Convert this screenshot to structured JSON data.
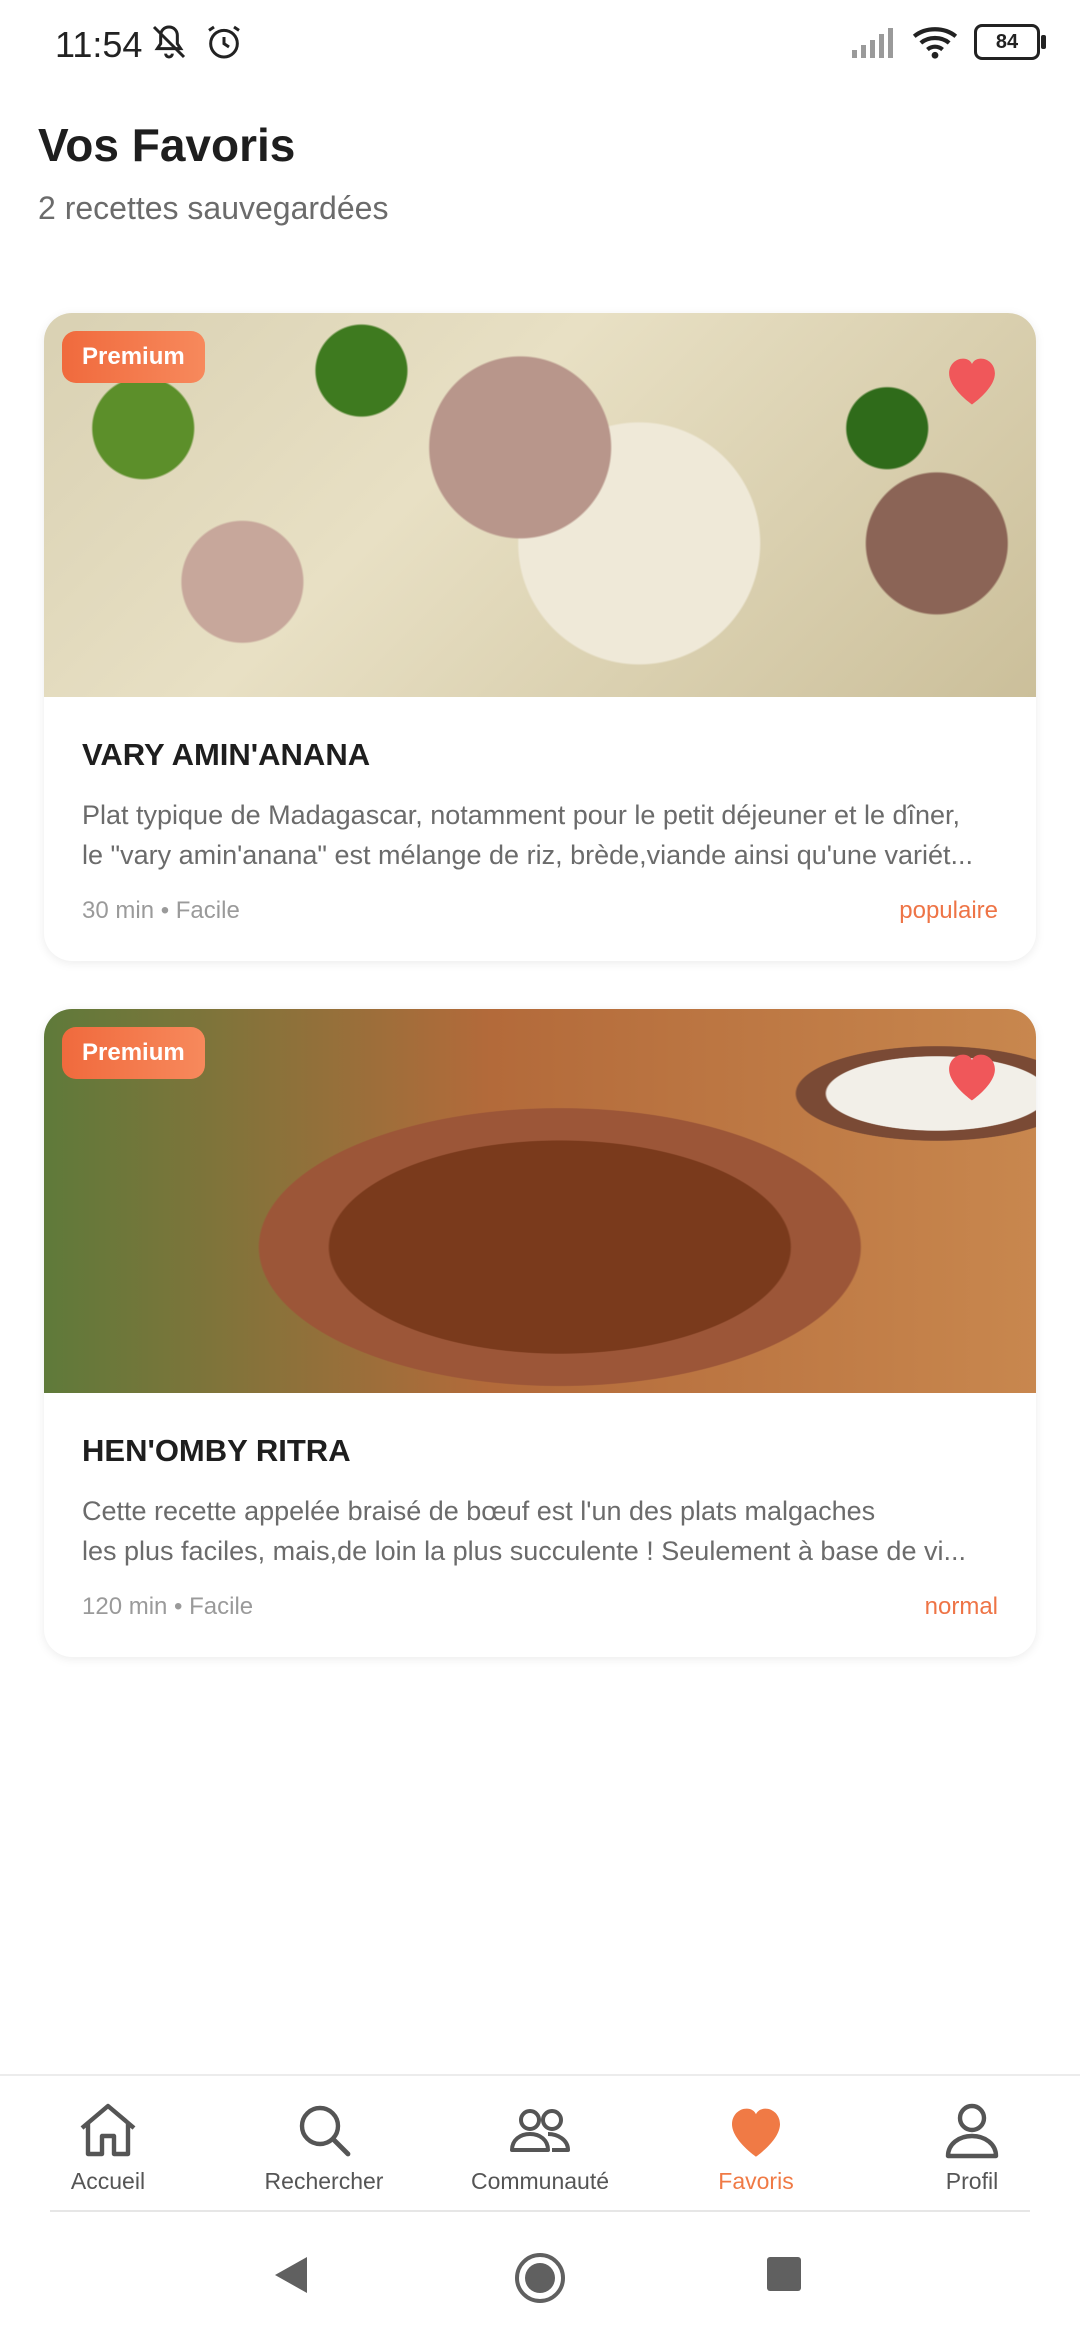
{
  "status_bar": {
    "time": "11:54",
    "battery": "84",
    "icons": [
      "bell-off-icon",
      "alarm-icon",
      "signal-icon",
      "wifi-icon",
      "battery-icon"
    ]
  },
  "header": {
    "title": "Vos Favoris",
    "subtitle": "2 recettes sauvegardées"
  },
  "recipes": [
    {
      "badge": "Premium",
      "title": "VARY AMIN'ANANA",
      "description_line1": "Plat typique de Madagascar, notamment pour le petit déjeuner et le dîner,",
      "description_line2": "le \"vary amin'anana\" est mélange de riz, brède,viande ainsi qu'une variét...",
      "meta": "30 min • Facile",
      "tag": "populaire",
      "favorite": true
    },
    {
      "badge": "Premium",
      "title": "HEN'OMBY RITRA",
      "description_line1": "Cette recette appelée braisé de bœuf est l'un des plats malgaches",
      "description_line2": "les plus faciles, mais,de loin la plus succulente ! Seulement à base de vi...",
      "meta": "120 min • Facile",
      "tag": "normal",
      "favorite": true
    }
  ],
  "bottom_nav": {
    "items": [
      {
        "label": "Accueil",
        "icon": "home-icon"
      },
      {
        "label": "Rechercher",
        "icon": "search-icon"
      },
      {
        "label": "Communauté",
        "icon": "community-icon"
      },
      {
        "label": "Favoris",
        "icon": "heart-icon",
        "active": true
      },
      {
        "label": "Profil",
        "icon": "profile-icon"
      }
    ]
  },
  "colors": {
    "accent": "#f07a45",
    "heart": "#f0575a",
    "premium_gradient_start": "#f06a3d",
    "premium_gradient_end": "#f7895c"
  }
}
